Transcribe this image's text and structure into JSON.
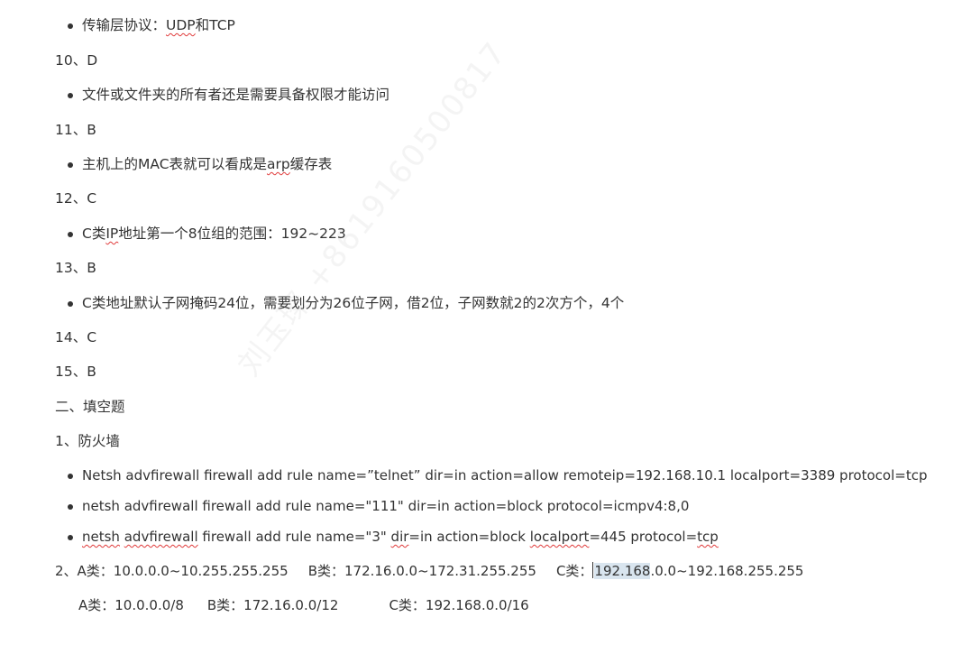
{
  "lines": {
    "l1": [
      "传输层协议：",
      "UDP",
      "和TCP"
    ],
    "l2": "10、D",
    "l3": "文件或文件夹的所有者还是需要具备权限才能访问",
    "l4": "11、B",
    "l5": [
      "主机上的MAC表就可以看成是",
      "arp",
      "缓存表"
    ],
    "l6": "12、C",
    "l7": [
      "C类",
      "IP",
      "地址第一个8位组的范围：192~223"
    ],
    "l8": "13、B",
    "l9": "C类地址默认子网掩码24位，需要划分为26位子网，借2位，子网数就2的2次方个，4个",
    "l10": "14、C",
    "l11": "15、B",
    "l12": "二、填空题",
    "l13": "1、防火墙",
    "l14": "Netsh advfirewall firewall add rule name=”telnet” dir=in action=allow remoteip=192.168.10.1 localport=3389 protocol=tcp",
    "l15": "netsh advfirewall firewall add rule name=\"111\" dir=in action=block protocol=icmpv4:8,0",
    "l16": [
      "netsh",
      " ",
      "advfirewall",
      " firewall add rule name=\"3\" ",
      "dir",
      "=in action=block ",
      "localport",
      "=445 protocol=",
      "tcp"
    ],
    "l17": {
      "a": "2、A类：10.0.0.0~10.255.255.255",
      "b": "B类：172.16.0.0~172.31.255.255",
      "c_prefix": "C类：",
      "c_sel": "192.168",
      "c_rest": ".0.0~192.168.255.255"
    },
    "l18": {
      "a": "A类：10.0.0.0/8",
      "b": "B类：172.16.0.0/12",
      "c": "C类：192.168.0.0/16"
    }
  },
  "watermark": "刘玉璨 +8619160500817"
}
